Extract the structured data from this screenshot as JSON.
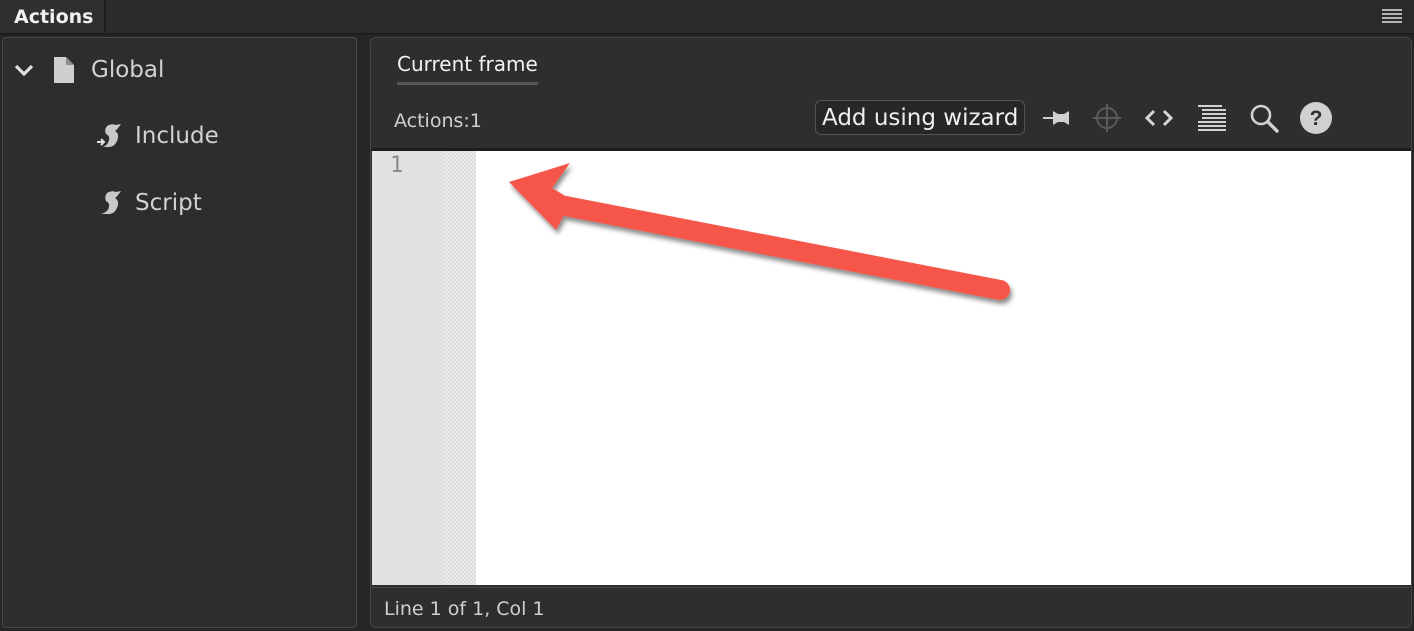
{
  "panel": {
    "title": "Actions"
  },
  "tree": {
    "items": [
      {
        "label": "Global",
        "icon": "document-icon",
        "expanded": true
      },
      {
        "label": "Include",
        "icon": "script-include-icon"
      },
      {
        "label": "Script",
        "icon": "script-icon"
      }
    ]
  },
  "editor": {
    "tab_label": "Current frame",
    "actions_label": "Actions:1",
    "wizard_button": "Add using wizard",
    "toolbar_icons": [
      "pin-icon",
      "target-icon",
      "code-snippets-icon",
      "format-code-icon",
      "find-icon",
      "help-icon"
    ],
    "line_numbers": [
      "1"
    ],
    "code": ""
  },
  "status": {
    "position": "Line 1 of 1, Col 1"
  },
  "annotation": {
    "type": "arrow",
    "color": "#f5574a",
    "points_to": "line 1 code start"
  }
}
